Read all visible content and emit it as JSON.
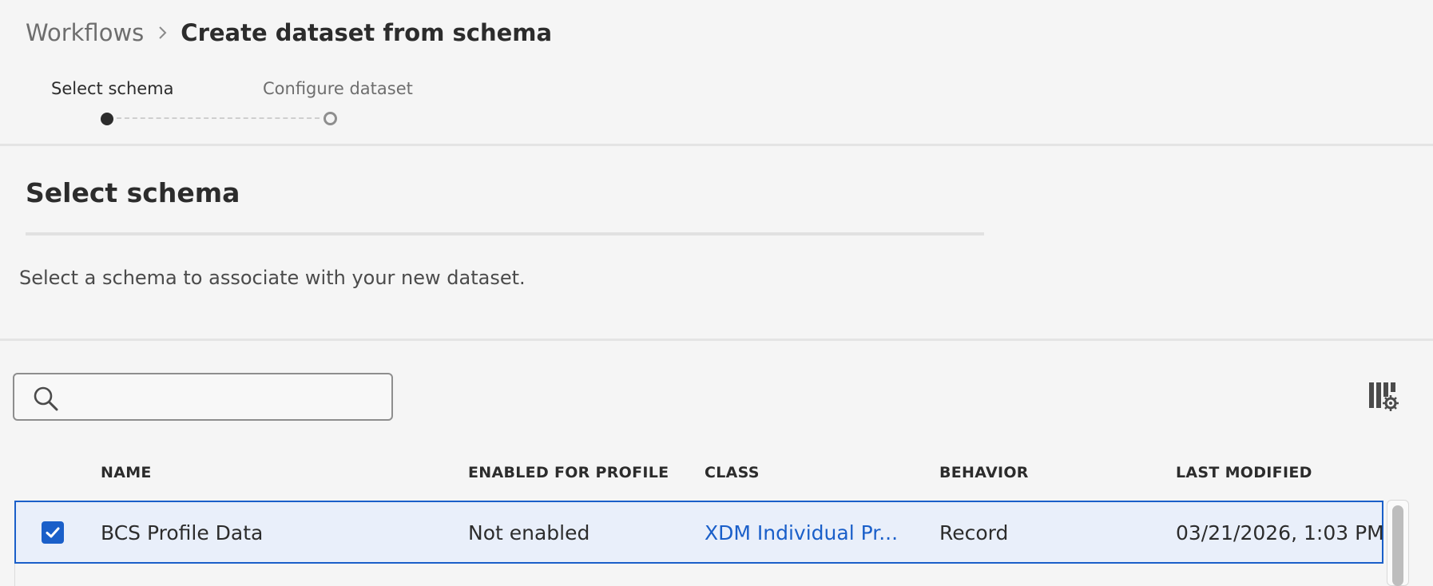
{
  "breadcrumb": {
    "parent": "Workflows",
    "current": "Create dataset from schema"
  },
  "stepper": {
    "steps": [
      {
        "label": "Select schema",
        "status": "active"
      },
      {
        "label": "Configure dataset",
        "status": "inactive"
      }
    ]
  },
  "section": {
    "title": "Select schema",
    "description": "Select a schema to associate with your new dataset."
  },
  "search": {
    "value": "",
    "icon": "search-icon"
  },
  "toolbar": {
    "column_settings_icon": "column-settings-icon"
  },
  "table": {
    "columns": [
      "NAME",
      "ENABLED FOR PROFILE",
      "CLASS",
      "BEHAVIOR",
      "LAST MODIFIED"
    ],
    "rows": [
      {
        "selected": true,
        "name": "BCS Profile Data",
        "enabled_for_profile": "Not enabled",
        "class": "XDM Individual Pr...",
        "behavior": "Record",
        "last_modified": "03/21/2026, 1:03 PM"
      }
    ]
  },
  "colors": {
    "accent": "#1a5fc9",
    "selected_row_bg": "#e9effa",
    "page_bg": "#f5f5f5"
  }
}
